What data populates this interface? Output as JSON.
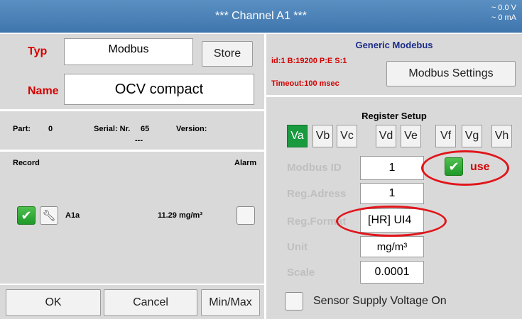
{
  "window": {
    "title": "*** Channel A1 ***",
    "voltage": "~ 0.0 V",
    "current": "~ 0 mA"
  },
  "left": {
    "typ_label": "Typ",
    "typ_value": "Modbus",
    "store_label": "Store",
    "name_label": "Name",
    "name_value": "OCV compact",
    "part_label": "Part:",
    "part_value": "0",
    "serial_label": "Serial: Nr.",
    "serial_value": "65",
    "version_label": "Version:",
    "version_value": "---",
    "record_label": "Record",
    "alarm_label": "Alarm",
    "channel_name": "A1a",
    "channel_value": "11.29 mg/m³"
  },
  "right": {
    "header": "Generic Modebus",
    "info_line1": "id:1 B:19200 P:E S:1",
    "info_line2": "Timeout:100 msec",
    "modbus_settings_label": "Modbus Settings",
    "register_setup": "Register Setup",
    "tabs": [
      "Va",
      "Vb",
      "Vc",
      "Vd",
      "Ve",
      "Vf",
      "Vg",
      "Vh"
    ],
    "active_tab": "Va",
    "modbus_id_label": "Modbus ID",
    "modbus_id_value": "1",
    "use_label": "use",
    "reg_adress_label": "Reg.Adress",
    "reg_adress_value": "1",
    "reg_format_label": "Reg.Format",
    "reg_format_value": "[HR] UI4",
    "unit_label": "Unit",
    "unit_value": "mg/m³",
    "scale_label": "Scale",
    "scale_value": "0.0001",
    "sensor_supply_label": "Sensor Supply Voltage On"
  },
  "footer": {
    "ok_label": "OK",
    "cancel_label": "Cancel",
    "minmax_label": "Min/Max"
  },
  "colors": {
    "titlebar": "#4a80b8",
    "panel": "#d9d9d9",
    "accent_red": "#d40000",
    "active_tab": "#1a9a3f",
    "annotation_red": "#e0161b"
  }
}
